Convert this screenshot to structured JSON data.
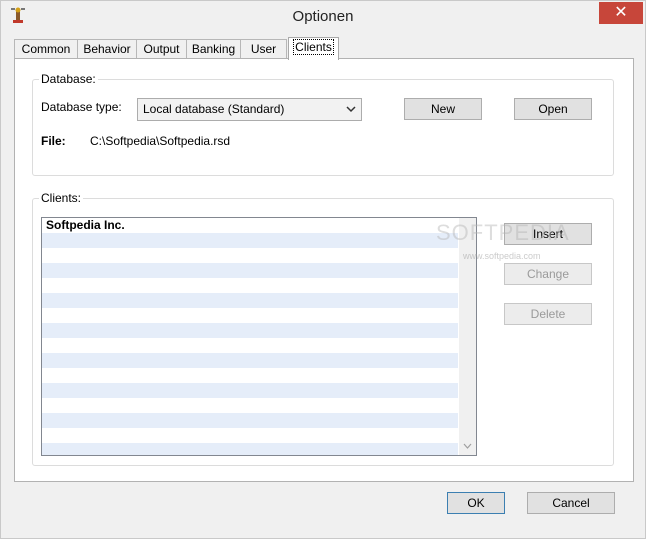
{
  "window": {
    "title": "Optionen",
    "close_label": "✕"
  },
  "tabs": [
    {
      "label": "Common",
      "active": false
    },
    {
      "label": "Behavior",
      "active": false
    },
    {
      "label": "Output",
      "active": false
    },
    {
      "label": "Banking",
      "active": false
    },
    {
      "label": "User",
      "active": false
    },
    {
      "label": "Clients",
      "active": true
    }
  ],
  "database": {
    "group_label": "Database:",
    "type_label": "Database type:",
    "type_value": "Local database (Standard)",
    "new_label": "New",
    "open_label": "Open",
    "file_label": "File:",
    "file_value": "C:\\Softpedia\\Softpedia.rsd"
  },
  "clients": {
    "group_label": "Clients:",
    "items": [
      "Softpedia Inc."
    ],
    "insert_label": "Insert",
    "change_label": "Change",
    "delete_label": "Delete",
    "watermark": "SOFTPEDIA",
    "watermark_url": "www.softpedia.com"
  },
  "footer": {
    "ok_label": "OK",
    "cancel_label": "Cancel"
  },
  "colors": {
    "row_stripe": "#e5edf9",
    "close_button": "#c7463a",
    "default_button_border": "#3c7fb1"
  },
  "icons": {
    "app": "app-icon",
    "dropdown": "chevron-down-icon",
    "scroll": "chevron-down-icon"
  }
}
